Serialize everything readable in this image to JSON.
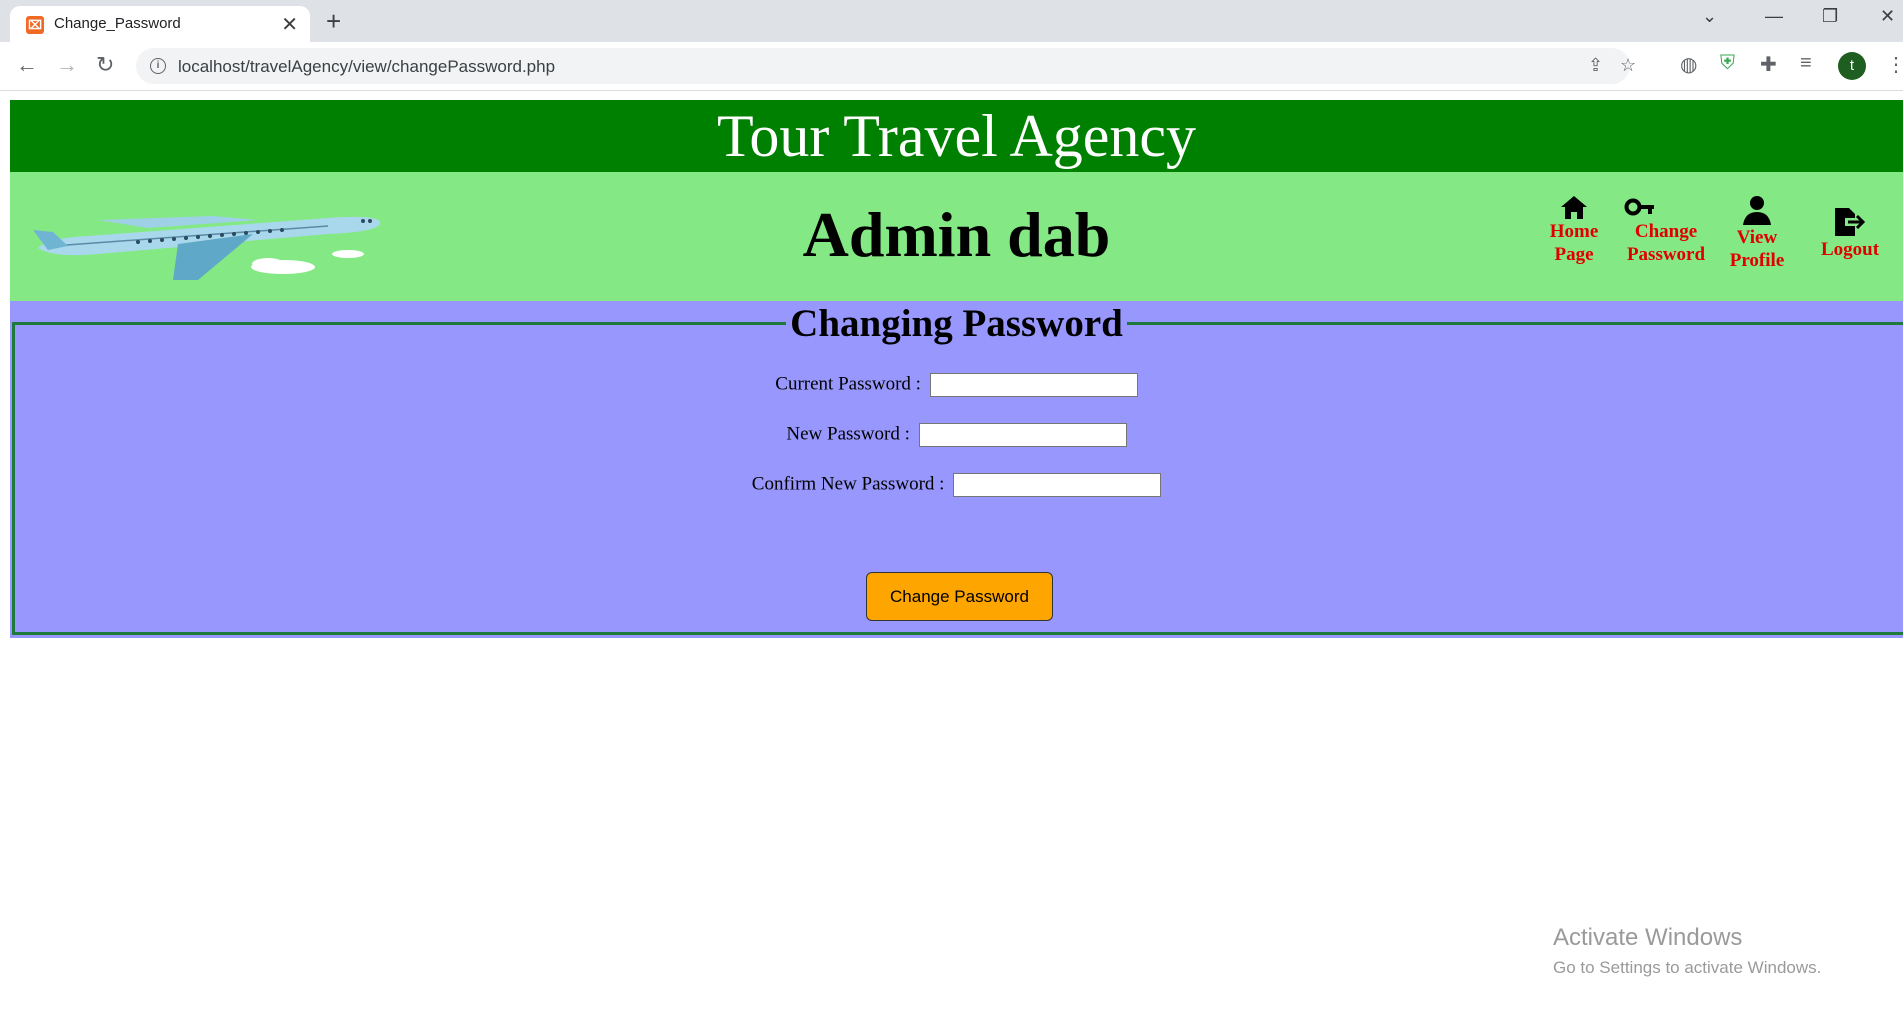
{
  "browser": {
    "tab_title": "Change_Password",
    "url": "localhost/travelAgency/view/changePassword.php",
    "profile_initial": "t"
  },
  "page": {
    "site_title": "Tour Travel Agency",
    "admin_name": "Admin dab",
    "nav": [
      {
        "label_line1": "Home",
        "label_line2": "Page",
        "icon": "home-icon"
      },
      {
        "label_line1": "Change",
        "label_line2": "Password",
        "icon": "key-icon"
      },
      {
        "label_line1": "View",
        "label_line2": "Profile",
        "icon": "user-icon"
      },
      {
        "label_line1": "Logout",
        "label_line2": "",
        "icon": "logout-icon"
      }
    ],
    "form": {
      "legend": "Changing Password",
      "current_label": "Current Password :",
      "new_label": "New Password :",
      "confirm_label": "Confirm New Password :",
      "current_value": "",
      "new_value": "",
      "confirm_value": "",
      "submit_label": "Change Password"
    }
  },
  "watermark": {
    "title": "Activate Windows",
    "subtitle": "Go to Settings to activate Windows."
  },
  "colors": {
    "title_bar": "#008000",
    "header_bar": "#84e984",
    "content_bg": "#9797fe",
    "nav_text": "#e00000",
    "button_bg": "#ffa500"
  }
}
